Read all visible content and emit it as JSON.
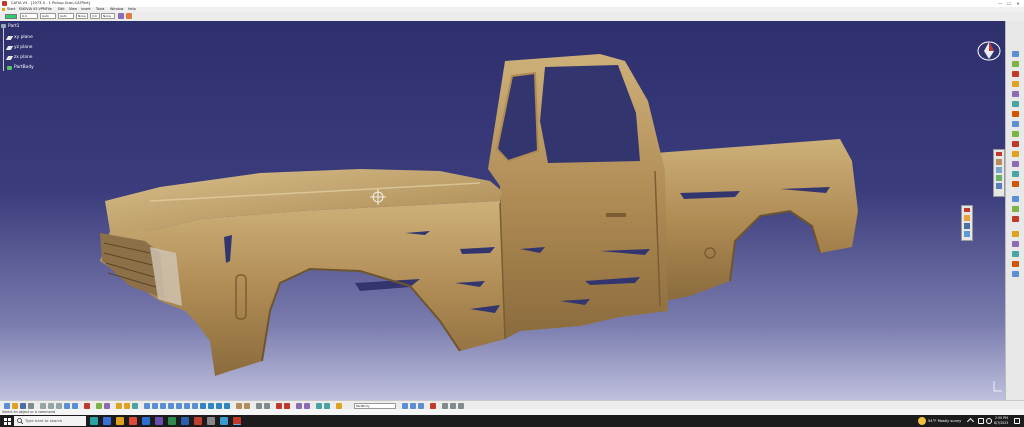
{
  "window": {
    "title": "CATIA V5 - [1973-5 - 1 Pickup Scan.CATPart]",
    "min": "—",
    "max": "☐",
    "close": "✕"
  },
  "menu": [
    "Start",
    "ENOVIA V5 VPM",
    "File",
    "Edit",
    "View",
    "Insert",
    "Tools",
    "Window",
    "Help"
  ],
  "toolbar": {
    "selects": [
      "0.0",
      "Auto",
      "Auto",
      "None",
      "0.0",
      "None"
    ]
  },
  "tree": {
    "root": "Part1",
    "items": [
      "xy plane",
      "yz plane",
      "zx plane",
      "PartBody"
    ]
  },
  "bottom_toolbar": {
    "current_body": "PartBody"
  },
  "status": {
    "text": "Select an object or a command"
  },
  "taskbar": {
    "search_placeholder": "Type here to search",
    "weather": "54°F Mostly sunny",
    "time": "2:50 PM",
    "date": "8/7/2023"
  },
  "colors": {
    "background_top": "#2e2f6d",
    "background_bottom": "#bfc0dd",
    "model": "#b8955a",
    "accent": "#c0392b"
  }
}
